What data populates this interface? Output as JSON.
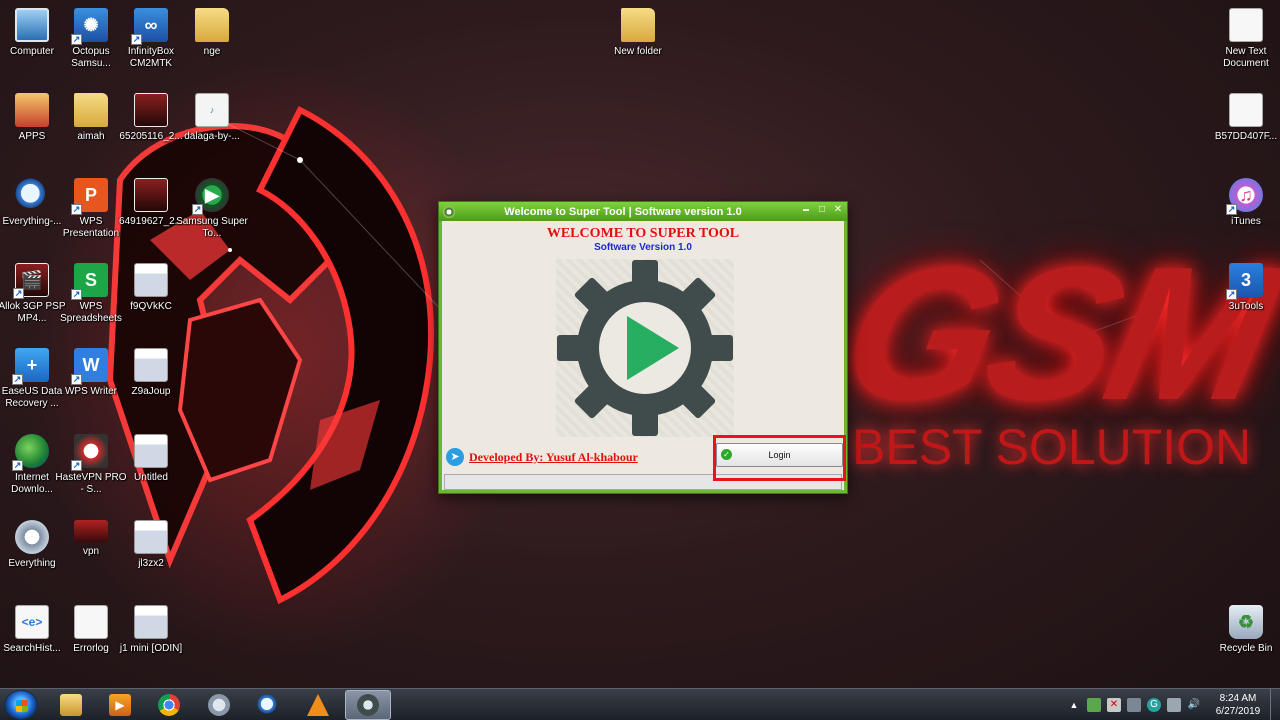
{
  "desktop": {
    "icons": [
      {
        "label": "Computer",
        "icon": "computer-icon"
      },
      {
        "label": "Octopus Samsu...",
        "icon": "octopus-icon"
      },
      {
        "label": "InfinityBox CM2MTK",
        "icon": "infinitybox-icon"
      },
      {
        "label": "nge",
        "icon": "folder-image-icon"
      },
      {
        "label": "New folder",
        "icon": "folder-icon"
      },
      {
        "label": "New Text Document",
        "icon": "text-document-icon"
      },
      {
        "label": "APPS",
        "icon": "folder-icon"
      },
      {
        "label": "aimah",
        "icon": "folder-icon"
      },
      {
        "label": "65205116_2...",
        "icon": "image-icon"
      },
      {
        "label": "dalaga-by-...",
        "icon": "mp3-icon"
      },
      {
        "label": "B57DD407F...",
        "icon": "text-document-icon"
      },
      {
        "label": "Everything-...",
        "icon": "search-icon"
      },
      {
        "label": "WPS Presentation",
        "icon": "wps-presentation-icon"
      },
      {
        "label": "64919627_2...",
        "icon": "image-icon"
      },
      {
        "label": "Samsung Super To...",
        "icon": "samsung-super-tool-icon"
      },
      {
        "label": "iTunes",
        "icon": "itunes-icon"
      },
      {
        "label": "Allok 3GP PSP MP4...",
        "icon": "allok-icon"
      },
      {
        "label": "WPS Spreadsheets",
        "icon": "wps-spreadsheets-icon"
      },
      {
        "label": "f9QVkKC",
        "icon": "screenshot-icon"
      },
      {
        "label": "3uTools",
        "icon": "3utools-icon"
      },
      {
        "label": "EaseUS Data Recovery ...",
        "icon": "easeus-icon"
      },
      {
        "label": "WPS Writer",
        "icon": "wps-writer-icon"
      },
      {
        "label": "Z9aJoup",
        "icon": "screenshot-icon"
      },
      {
        "label": "Internet Downlo...",
        "icon": "idm-icon"
      },
      {
        "label": "HasteVPN PRO - S...",
        "icon": "hastevpn-icon"
      },
      {
        "label": "Untitled",
        "icon": "screenshot-icon"
      },
      {
        "label": "Everything",
        "icon": "gear-icon"
      },
      {
        "label": "vpn",
        "icon": "vpn-icon"
      },
      {
        "label": "jl3zx2",
        "icon": "screenshot-icon"
      },
      {
        "label": "SearchHist...",
        "icon": "search-history-icon"
      },
      {
        "label": "Errorlog",
        "icon": "text-document-icon"
      },
      {
        "label": "j1 mini [ODIN]",
        "icon": "screenshot-icon"
      },
      {
        "label": "Recycle Bin",
        "icon": "recycle-bin-icon"
      }
    ],
    "wallpaper": {
      "brand": "GSM",
      "tagline": "BEST SOLUTION"
    }
  },
  "window": {
    "title": "Welcome to Super Tool | Software version 1.0",
    "heading": "WELCOME TO SUPER TOOL",
    "subheading": "Software Version 1.0",
    "developer": "Developed By: Yusuf Al-khabour",
    "login_label": "Login",
    "progress": 0,
    "minimize_glyph": "▬",
    "maximize_glyph": "□",
    "close_glyph": "✕"
  },
  "taskbar": {
    "pinned": [
      "file-explorer-icon",
      "media-player-icon",
      "chrome-icon",
      "driver-tool-icon",
      "search-tool-icon",
      "vlc-icon",
      "super-tool-icon"
    ],
    "active": "super-tool-icon",
    "clock_time": "8:24 AM",
    "clock_date": "6/27/2019"
  },
  "colors": {
    "title_green": "#6fb52f",
    "heading_red": "#e01010",
    "subheading_blue": "#1a2ad0",
    "gear_dark": "#3f4c4b",
    "play_green": "#27ae60",
    "highlight_red": "#e8141c"
  }
}
